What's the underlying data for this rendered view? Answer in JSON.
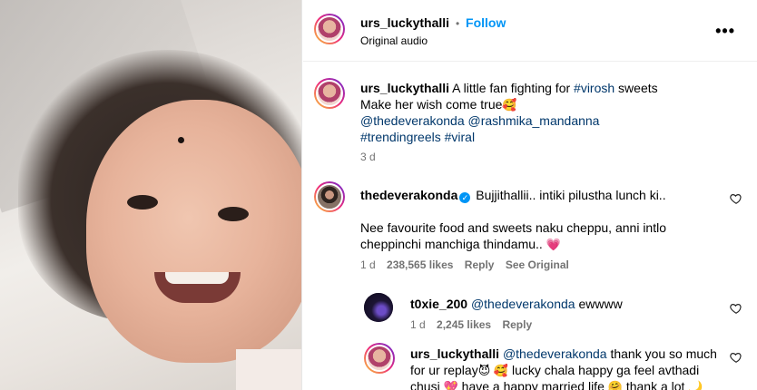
{
  "post_header": {
    "username": "urs_luckythalli",
    "separator": "•",
    "follow_label": "Follow",
    "audio_label": "Original audio",
    "more_label": "•••"
  },
  "caption": {
    "username": "urs_luckythalli",
    "text_prefix": "A little fan fighting for ",
    "hashtag_virosh": "#virosh",
    "text_suffix": " sweets",
    "line2": "Make her wish come true",
    "line2_emoji": "🥰",
    "mention_1": "@thedeverakonda",
    "mention_2": "@rashmika_mandanna",
    "hashtag_trending": "#trendingreels",
    "hashtag_viral": "#viral",
    "age": "3 d"
  },
  "comments": [
    {
      "username": "thedeverakonda",
      "verified_icon": "verified-badge",
      "line1": "Bujjithallii.. intiki pilustha lunch ki..",
      "line2": "Nee favourite food and sweets naku cheppu, anni intlo",
      "line3": "cheppinchi manchiga thindamu..",
      "line3_emoji": "💗",
      "age": "1 d",
      "likes": "238,565 likes",
      "reply": "Reply",
      "see_original": "See Original"
    },
    {
      "username": "t0xie_200",
      "mention": "@thedeverakonda",
      "text": " ewwww",
      "age": "1 d",
      "likes": "2,245 likes",
      "reply": "Reply"
    },
    {
      "username": "urs_luckythalli",
      "mention": "@thedeverakonda",
      "line1": " thank you so much",
      "line2_prefix": "for ur replay",
      "line2_emoji": "😈 🥰",
      "line2_suffix": "  lucky chala happy ga feel avthadi",
      "line3_prefix": "chusi ",
      "line3_emoji": "💖",
      "line3_suffix": " have a happy married life ",
      "line3_emoji2": "🤗",
      "line3_tail": " thank a lot ",
      "line3_emoji3": "🌙"
    }
  ],
  "colors": {
    "link": "#00376b",
    "follow": "#0095f6",
    "muted": "#737373"
  },
  "icons": {
    "more": "more-options-icon",
    "heart": "heart-outline-icon"
  }
}
